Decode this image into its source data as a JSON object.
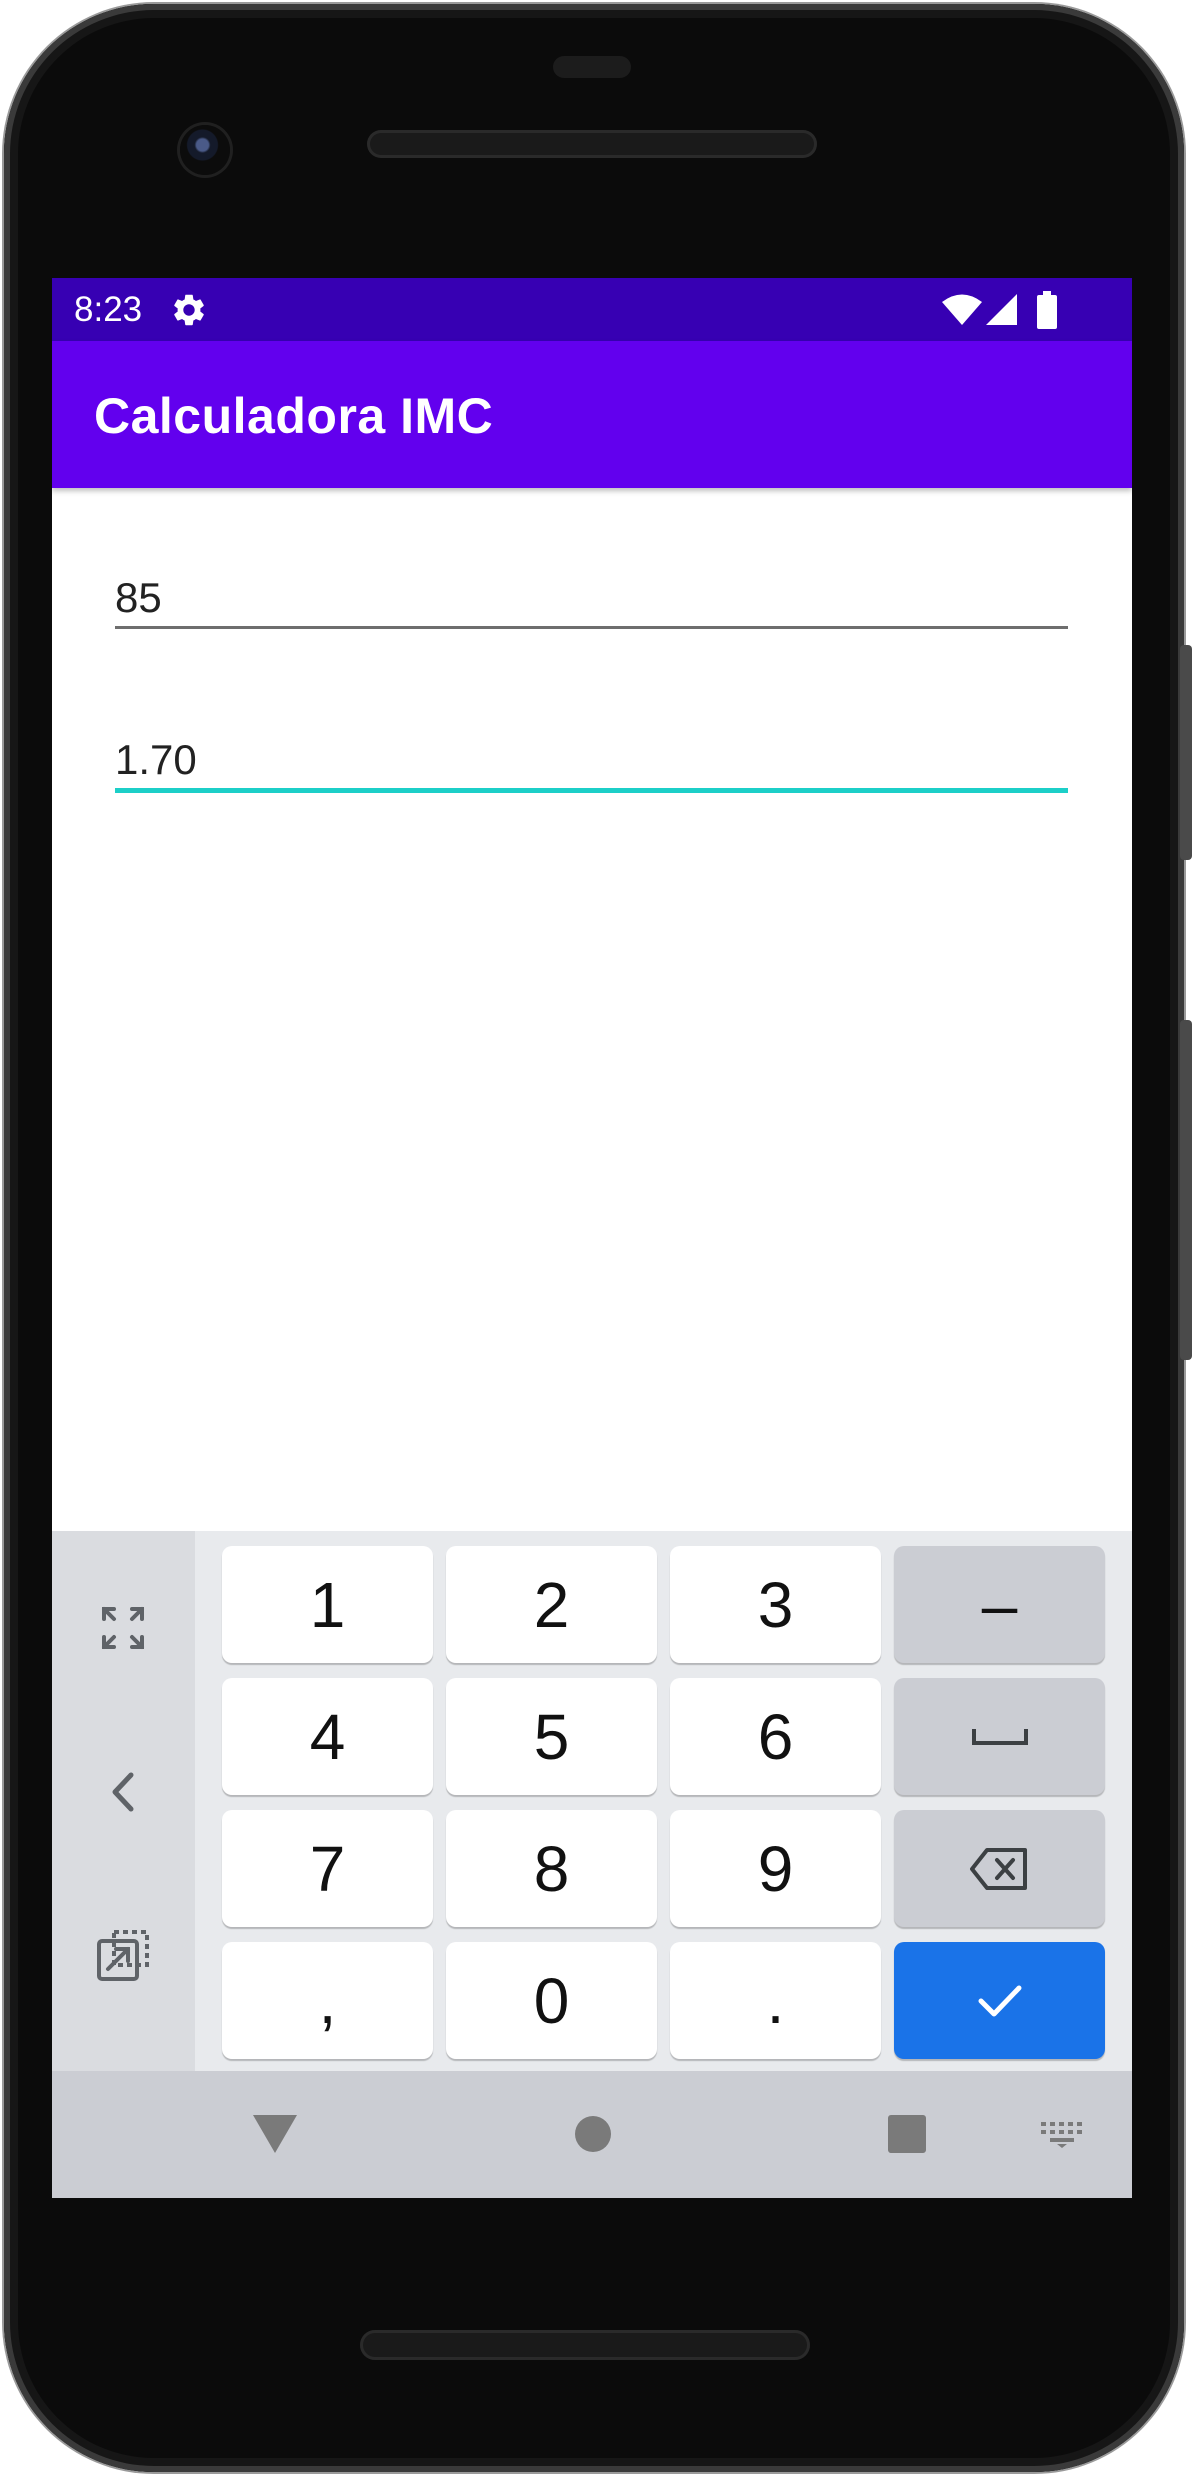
{
  "status_bar": {
    "time": "8:23",
    "icons": [
      "settings-icon",
      "wifi-icon",
      "cell-signal-icon",
      "battery-icon"
    ]
  },
  "app_bar": {
    "title": "Calculadora IMC",
    "color": "#6200ee"
  },
  "form": {
    "weight": {
      "value": "85"
    },
    "height": {
      "value": "1.70",
      "focused": true,
      "accent_color": "#1ccfc8"
    }
  },
  "keyboard": {
    "side_icons": [
      "fullscreen-icon",
      "back-arrow-icon",
      "floating-keyboard-icon"
    ],
    "rows": [
      [
        "1",
        "2",
        "3",
        "–"
      ],
      [
        "4",
        "5",
        "6",
        "space"
      ],
      [
        "7",
        "8",
        "9",
        "backspace"
      ],
      [
        ",",
        "0",
        ".",
        "done"
      ]
    ],
    "labels": {
      "k1": "1",
      "k2": "2",
      "k3": "3",
      "dash": "–",
      "k4": "4",
      "k5": "5",
      "k6": "6",
      "k7": "7",
      "k8": "8",
      "k9": "9",
      "comma": ",",
      "k0": "0",
      "dot": "."
    },
    "enter_color": "#1a73e8"
  },
  "nav_bar": {
    "icons": [
      "back-triangle-icon",
      "home-circle-icon",
      "recents-square-icon",
      "keyboard-switch-icon"
    ]
  }
}
